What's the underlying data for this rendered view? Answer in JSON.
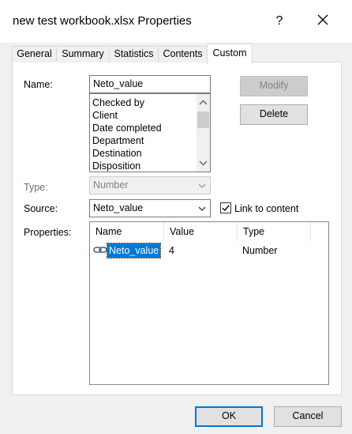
{
  "window": {
    "title": "new test workbook.xlsx Properties",
    "help_symbol": "?"
  },
  "tabs": [
    {
      "label": "General"
    },
    {
      "label": "Summary"
    },
    {
      "label": "Statistics"
    },
    {
      "label": "Contents"
    },
    {
      "label": "Custom"
    }
  ],
  "active_tab": "Custom",
  "custom": {
    "name_label": "Name:",
    "name_value": "Neto_value",
    "name_list": [
      "Checked by",
      "Client",
      "Date completed",
      "Department",
      "Destination",
      "Disposition"
    ],
    "type_label": "Type:",
    "type_value": "Number",
    "source_label": "Source:",
    "source_value": "Neto_value",
    "link_label": "Link to content",
    "link_checked": true,
    "properties_label": "Properties:",
    "columns": [
      "Name",
      "Value",
      "Type"
    ],
    "rows": [
      {
        "name": "Neto_value",
        "value": "4",
        "type": "Number"
      }
    ],
    "modify_label": "Modify",
    "delete_label": "Delete"
  },
  "footer": {
    "ok_label": "OK",
    "cancel_label": "Cancel"
  },
  "colors": {
    "selection": "#0078d7",
    "default_button_border": "#0078d7"
  }
}
